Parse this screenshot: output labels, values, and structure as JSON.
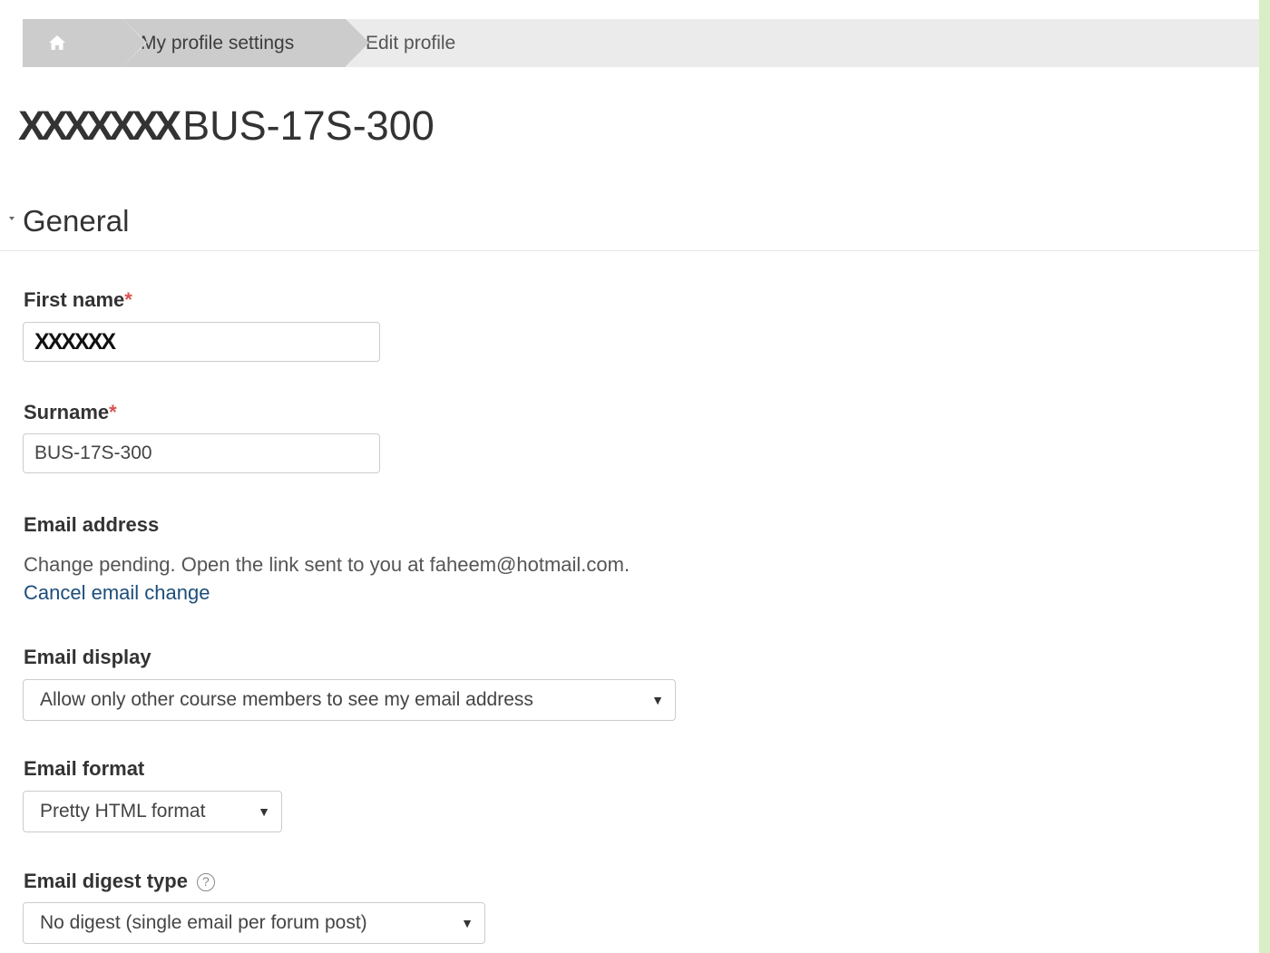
{
  "breadcrumb": {
    "home_icon": "home-icon",
    "items": [
      {
        "label": "My profile settings"
      },
      {
        "label": "Edit profile"
      }
    ]
  },
  "page": {
    "title_redacted": "XXXXXXX",
    "title_rest": "BUS-17S-300"
  },
  "section": {
    "title": "General"
  },
  "form": {
    "first_name": {
      "label": "First name",
      "required_mark": "*",
      "value": "XXXXXX"
    },
    "surname": {
      "label": "Surname",
      "required_mark": "*",
      "value": "BUS-17S-300"
    },
    "email_address": {
      "label": "Email address",
      "message": "Change pending. Open the link sent to you at faheem@hotmail.com.",
      "cancel_link": "Cancel email change"
    },
    "email_display": {
      "label": "Email display",
      "selected": "Allow only other course members to see my email address",
      "arrow": "▼"
    },
    "email_format": {
      "label": "Email format",
      "selected": "Pretty HTML format",
      "arrow": "▼"
    },
    "email_digest_type": {
      "label": "Email digest type",
      "help": "?",
      "selected": "No digest (single email per forum post)",
      "arrow": "▼"
    }
  },
  "colors": {
    "outer_background": "#d9eec6",
    "breadcrumb_background": "#ebebeb",
    "breadcrumb_active": "#cccccc",
    "required_star": "#d9534f",
    "link": "#1c4e7a"
  }
}
